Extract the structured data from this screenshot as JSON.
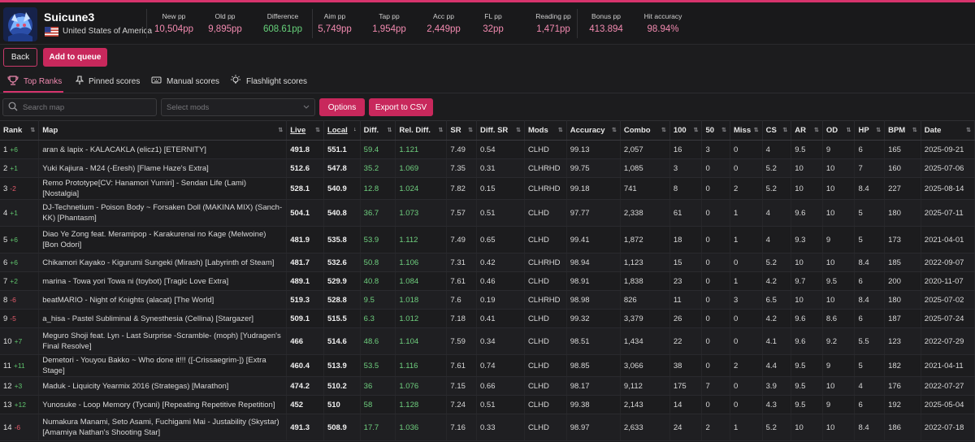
{
  "user": {
    "name": "Suicune3",
    "country": "United States of America"
  },
  "stats": [
    {
      "label": "New pp",
      "value": "10,504pp",
      "color": "pink"
    },
    {
      "label": "Old pp",
      "value": "9,895pp",
      "color": "pink"
    },
    {
      "label": "Difference",
      "value": "608.61pp",
      "color": "green"
    },
    {
      "label": "Aim pp",
      "value": "5,749pp",
      "color": "pink"
    },
    {
      "label": "Tap pp",
      "value": "1,954pp",
      "color": "pink"
    },
    {
      "label": "Acc pp",
      "value": "2,449pp",
      "color": "pink"
    },
    {
      "label": "FL pp",
      "value": "32pp",
      "color": "pink"
    },
    {
      "label": "Reading pp",
      "value": "1,471pp",
      "color": "pink"
    },
    {
      "label": "Bonus pp",
      "value": "413.894",
      "color": "pink"
    },
    {
      "label": "Hit accuracy",
      "value": "98.94%",
      "color": "pink"
    }
  ],
  "actions": {
    "back": "Back",
    "add_to_queue": "Add to queue"
  },
  "tabs": [
    "Top Ranks",
    "Pinned scores",
    "Manual scores",
    "Flashlight scores"
  ],
  "filters": {
    "search_placeholder": "Search map",
    "mods_placeholder": "Select mods",
    "options": "Options",
    "export": "Export to CSV"
  },
  "columns": [
    "Rank",
    "Map",
    "Live",
    "Local",
    "Diff.",
    "Rel. Diff.",
    "SR",
    "Diff. SR",
    "Mods",
    "Accuracy",
    "Combo",
    "100",
    "50",
    "Miss",
    "CS",
    "AR",
    "OD",
    "HP",
    "BPM",
    "Date"
  ],
  "rows": [
    {
      "rank": "1",
      "change": "+6",
      "dir": "up",
      "map": "aran & lapix - KALACAKLA (elicz1) [ETERNITY]",
      "live": "491.8",
      "local": "551.1",
      "diff": "59.4",
      "rel": "1.121",
      "sr": "7.49",
      "dsr": "0.54",
      "mods": "CLHD",
      "acc": "99.13",
      "combo": "2,057",
      "c100": "16",
      "c50": "3",
      "miss": "0",
      "cs": "4",
      "ar": "9.5",
      "od": "9",
      "hp": "6",
      "bpm": "165",
      "date": "2025-09-21"
    },
    {
      "rank": "2",
      "change": "+1",
      "dir": "up",
      "map": "Yuki Kajiura - M24 (-Eresh) [Flame Haze's Extra]",
      "live": "512.6",
      "local": "547.8",
      "diff": "35.2",
      "rel": "1.069",
      "sr": "7.35",
      "dsr": "0.31",
      "mods": "CLHRHD",
      "acc": "99.75",
      "combo": "1,085",
      "c100": "3",
      "c50": "0",
      "miss": "0",
      "cs": "5.2",
      "ar": "10",
      "od": "10",
      "hp": "7",
      "bpm": "160",
      "date": "2025-07-06"
    },
    {
      "rank": "3",
      "change": "-2",
      "dir": "down",
      "map": "Remo Prototype[CV: Hanamori Yumiri] - Sendan Life (Lami) [Nostalgia]",
      "live": "528.1",
      "local": "540.9",
      "diff": "12.8",
      "rel": "1.024",
      "sr": "7.82",
      "dsr": "0.15",
      "mods": "CLHRHD",
      "acc": "99.18",
      "combo": "741",
      "c100": "8",
      "c50": "0",
      "miss": "2",
      "cs": "5.2",
      "ar": "10",
      "od": "10",
      "hp": "8.4",
      "bpm": "227",
      "date": "2025-08-14"
    },
    {
      "rank": "4",
      "change": "+1",
      "dir": "up",
      "map": "DJ-Technetium - Poison Body ~ Forsaken Doll (MAKINA MIX) (Sanch-KK) [Phantasm]",
      "live": "504.1",
      "local": "540.8",
      "diff": "36.7",
      "rel": "1.073",
      "sr": "7.57",
      "dsr": "0.51",
      "mods": "CLHD",
      "acc": "97.77",
      "combo": "2,338",
      "c100": "61",
      "c50": "0",
      "miss": "1",
      "cs": "4",
      "ar": "9.6",
      "od": "10",
      "hp": "5",
      "bpm": "180",
      "date": "2025-07-11"
    },
    {
      "rank": "5",
      "change": "+6",
      "dir": "up",
      "map": "Diao Ye Zong feat. Meramipop - Karakurenai no Kage (Melwoine) [Bon Odori]",
      "live": "481.9",
      "local": "535.8",
      "diff": "53.9",
      "rel": "1.112",
      "sr": "7.49",
      "dsr": "0.65",
      "mods": "CLHD",
      "acc": "99.41",
      "combo": "1,872",
      "c100": "18",
      "c50": "0",
      "miss": "1",
      "cs": "4",
      "ar": "9.3",
      "od": "9",
      "hp": "5",
      "bpm": "173",
      "date": "2021-04-01"
    },
    {
      "rank": "6",
      "change": "+6",
      "dir": "up",
      "map": "Chikamori Kayako - Kigurumi Sungeki (Mirash) [Labyrinth of Steam]",
      "live": "481.7",
      "local": "532.6",
      "diff": "50.8",
      "rel": "1.106",
      "sr": "7.31",
      "dsr": "0.42",
      "mods": "CLHRHD",
      "acc": "98.94",
      "combo": "1,123",
      "c100": "15",
      "c50": "0",
      "miss": "0",
      "cs": "5.2",
      "ar": "10",
      "od": "10",
      "hp": "8.4",
      "bpm": "185",
      "date": "2022-09-07"
    },
    {
      "rank": "7",
      "change": "+2",
      "dir": "up",
      "map": "marina - Towa yori Towa ni (toybot) [Tragic Love Extra]",
      "live": "489.1",
      "local": "529.9",
      "diff": "40.8",
      "rel": "1.084",
      "sr": "7.61",
      "dsr": "0.46",
      "mods": "CLHD",
      "acc": "98.91",
      "combo": "1,838",
      "c100": "23",
      "c50": "0",
      "miss": "1",
      "cs": "4.2",
      "ar": "9.7",
      "od": "9.5",
      "hp": "6",
      "bpm": "200",
      "date": "2020-11-07"
    },
    {
      "rank": "8",
      "change": "-6",
      "dir": "down",
      "map": "beatMARIO - Night of Knights (alacat) [The World]",
      "live": "519.3",
      "local": "528.8",
      "diff": "9.5",
      "rel": "1.018",
      "sr": "7.6",
      "dsr": "0.19",
      "mods": "CLHRHD",
      "acc": "98.98",
      "combo": "826",
      "c100": "11",
      "c50": "0",
      "miss": "3",
      "cs": "6.5",
      "ar": "10",
      "od": "10",
      "hp": "8.4",
      "bpm": "180",
      "date": "2025-07-02"
    },
    {
      "rank": "9",
      "change": "-5",
      "dir": "down",
      "map": "a_hisa - Pastel Subliminal & Synesthesia (Cellina) [Stargazer]",
      "live": "509.1",
      "local": "515.5",
      "diff": "6.3",
      "rel": "1.012",
      "sr": "7.18",
      "dsr": "0.41",
      "mods": "CLHD",
      "acc": "99.32",
      "combo": "3,379",
      "c100": "26",
      "c50": "0",
      "miss": "0",
      "cs": "4.2",
      "ar": "9.6",
      "od": "8.6",
      "hp": "6",
      "bpm": "187",
      "date": "2025-07-24"
    },
    {
      "rank": "10",
      "change": "+7",
      "dir": "up",
      "map": "Meguro Shoji feat. Lyn - Last Surprise -Scramble- (moph) [Yudragen's Final Resolve]",
      "live": "466",
      "local": "514.6",
      "diff": "48.6",
      "rel": "1.104",
      "sr": "7.59",
      "dsr": "0.34",
      "mods": "CLHD",
      "acc": "98.51",
      "combo": "1,434",
      "c100": "22",
      "c50": "0",
      "miss": "0",
      "cs": "4.1",
      "ar": "9.6",
      "od": "9.2",
      "hp": "5.5",
      "bpm": "123",
      "date": "2022-07-29"
    },
    {
      "rank": "11",
      "change": "+11",
      "dir": "up",
      "map": "Demetori - Youyou Bakko ~ Who done it!!! ([-Crissaegrim-]) [Extra Stage]",
      "live": "460.4",
      "local": "513.9",
      "diff": "53.5",
      "rel": "1.116",
      "sr": "7.61",
      "dsr": "0.74",
      "mods": "CLHD",
      "acc": "98.85",
      "combo": "3,066",
      "c100": "38",
      "c50": "0",
      "miss": "2",
      "cs": "4.4",
      "ar": "9.5",
      "od": "9",
      "hp": "5",
      "bpm": "182",
      "date": "2021-04-11"
    },
    {
      "rank": "12",
      "change": "+3",
      "dir": "up",
      "map": "Maduk - Liquicity Yearmix 2016 (Strategas) [Marathon]",
      "live": "474.2",
      "local": "510.2",
      "diff": "36",
      "rel": "1.076",
      "sr": "7.15",
      "dsr": "0.66",
      "mods": "CLHD",
      "acc": "98.17",
      "combo": "9,112",
      "c100": "175",
      "c50": "7",
      "miss": "0",
      "cs": "3.9",
      "ar": "9.5",
      "od": "10",
      "hp": "4",
      "bpm": "176",
      "date": "2022-07-27"
    },
    {
      "rank": "13",
      "change": "+12",
      "dir": "up",
      "map": "Yunosuke - Loop Memory (Tycani) [Repeating Repetitive Repetition]",
      "live": "452",
      "local": "510",
      "diff": "58",
      "rel": "1.128",
      "sr": "7.24",
      "dsr": "0.51",
      "mods": "CLHD",
      "acc": "99.38",
      "combo": "2,143",
      "c100": "14",
      "c50": "0",
      "miss": "0",
      "cs": "4.3",
      "ar": "9.5",
      "od": "9",
      "hp": "6",
      "bpm": "192",
      "date": "2025-05-04"
    },
    {
      "rank": "14",
      "change": "-6",
      "dir": "down",
      "map": "Numakura Manami, Seto Asami, Fuchigami Mai - Justability (Skystar) [Amamiya Nathan's Shooting Star]",
      "live": "491.3",
      "local": "508.9",
      "diff": "17.7",
      "rel": "1.036",
      "sr": "7.16",
      "dsr": "0.33",
      "mods": "CLHD",
      "acc": "98.97",
      "combo": "2,633",
      "c100": "24",
      "c50": "2",
      "miss": "1",
      "cs": "5.2",
      "ar": "10",
      "od": "10",
      "hp": "8.4",
      "bpm": "186",
      "date": "2022-07-18"
    }
  ]
}
